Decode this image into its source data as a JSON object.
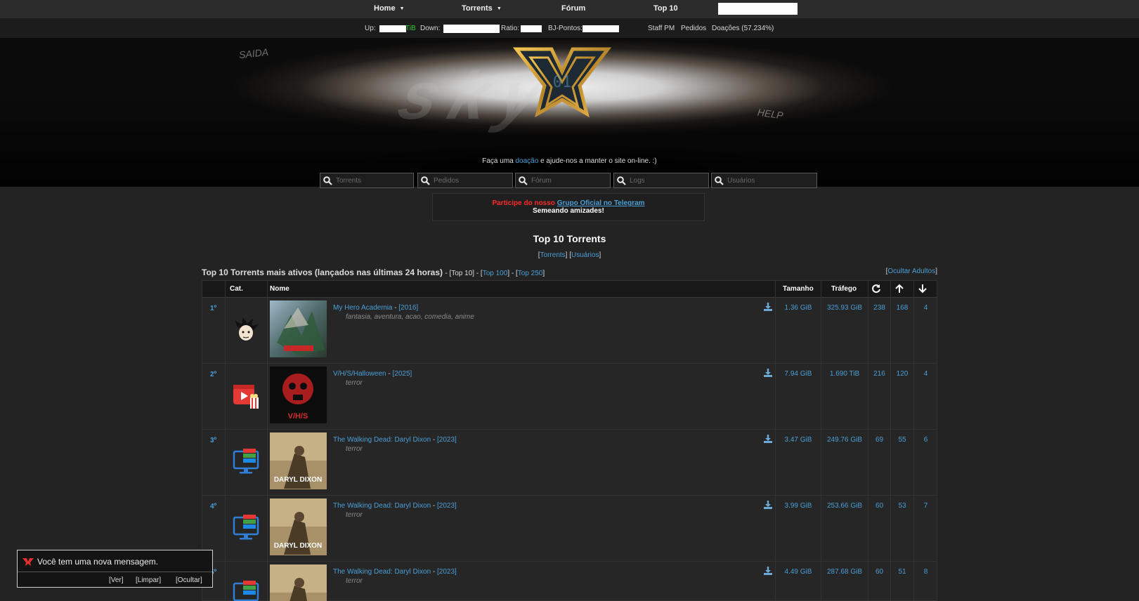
{
  "nav": {
    "home": "Home",
    "torrents": "Torrents",
    "forum": "Fórum",
    "top10": "Top 10"
  },
  "stats": {
    "up_label": "Up:",
    "up_unit": "TiB",
    "down_label": "Down:",
    "ratio_label": "Ratio:",
    "points_label": "BJ-Pontos:",
    "staff_pm": "Staff PM",
    "requests": "Pedidos",
    "donations": "Doações (57.234%)"
  },
  "banner": {
    "graffiti_left": "SAIDA",
    "graffiti_right": "HELP",
    "donate_pre": "Faça uma",
    "donate_link": "doação",
    "donate_post": "e ajude-nos a manter o site on-line. :)"
  },
  "search": {
    "torrents": "Torrents",
    "pedidos": "Pedidos",
    "forum": "Fórum",
    "logs": "Logs",
    "usuarios": "Usuários"
  },
  "notice": {
    "prefix": "Participe do nosso",
    "link": "Grupo Oficial no Telegram",
    "line2": "Semeando amizades!"
  },
  "page": {
    "title": "Top 10 Torrents",
    "sub_torrents": "Torrents",
    "sub_users": "Usuários",
    "section": "Top 10 Torrents mais ativos (lançados nas últimas 24 horas)",
    "top10": "Top 10",
    "top100": "Top 100",
    "top250": "Top 250",
    "hide_adults": "Ocultar Adultos"
  },
  "table": {
    "headers": {
      "cat": "Cat.",
      "name": "Nome",
      "size": "Tamanho",
      "traffic": "Tráfego"
    },
    "rows": [
      {
        "rank": "1º",
        "title": "My Hero Academia",
        "year": "[2016]",
        "tags": "fantasia, aventura, acao, comedia, anime",
        "size": "1.36 GiB",
        "traffic": "325.93 GiB",
        "completed": "238",
        "seeders": "168",
        "leechers": "4",
        "category": "anime",
        "poster": "mha"
      },
      {
        "rank": "2º",
        "title": "V/H/S/Halloween",
        "year": "[2025]",
        "tags": "terror",
        "size": "7.94 GiB",
        "traffic": "1.690 TiB",
        "completed": "216",
        "seeders": "120",
        "leechers": "4",
        "category": "movie",
        "poster": "vhs"
      },
      {
        "rank": "3º",
        "title": "The Walking Dead: Daryl Dixon",
        "year": "[2023]",
        "tags": "terror",
        "size": "3.47 GiB",
        "traffic": "249.76 GiB",
        "completed": "69",
        "seeders": "55",
        "leechers": "6",
        "category": "series",
        "poster": "daryl"
      },
      {
        "rank": "4º",
        "title": "The Walking Dead: Daryl Dixon",
        "year": "[2023]",
        "tags": "terror",
        "size": "3.99 GiB",
        "traffic": "253.66 GiB",
        "completed": "60",
        "seeders": "53",
        "leechers": "7",
        "category": "series",
        "poster": "daryl"
      },
      {
        "rank": "5º",
        "title": "The Walking Dead: Daryl Dixon",
        "year": "[2023]",
        "tags": "terror",
        "size": "4.49 GiB",
        "traffic": "287.68 GiB",
        "completed": "60",
        "seeders": "51",
        "leechers": "8",
        "category": "series",
        "poster": "daryl"
      }
    ]
  },
  "popup": {
    "message": "Você tem uma nova mensagem.",
    "view": "[Ver]",
    "clear": "[Limpar]",
    "hide": "[Ocultar]"
  },
  "poster_text": {
    "vhs": "V/H/S",
    "daryl": "DARYL DIXON"
  },
  "colors": {
    "link": "#4a9fd8",
    "accent_red": "#ff2a2a",
    "ratio_green": "#33cc33"
  }
}
